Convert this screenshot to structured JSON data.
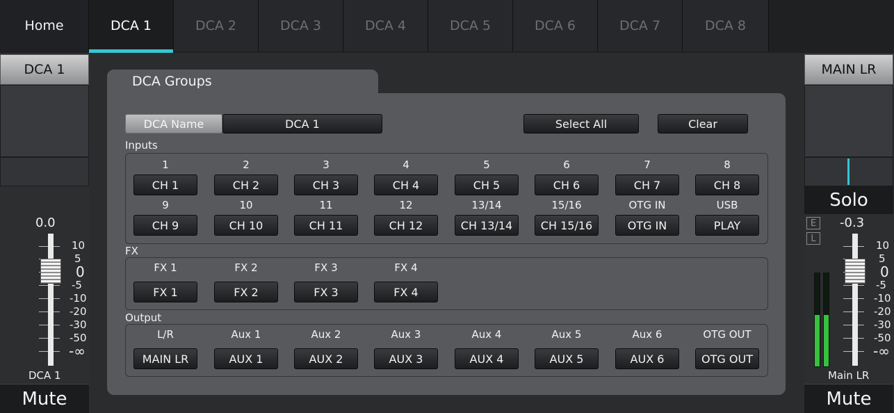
{
  "tabs": [
    "Home",
    "DCA 1",
    "DCA 2",
    "DCA 3",
    "DCA 4",
    "DCA 5",
    "DCA 6",
    "DCA 7",
    "DCA 8"
  ],
  "active_tab": "DCA 1",
  "left_strip": {
    "title": "DCA 1",
    "fader_value": "0.0",
    "name": "DCA 1",
    "mute": "Mute",
    "scale": [
      "10",
      "5",
      "0",
      "-5",
      "-10",
      "-20",
      "-30",
      "-50",
      "-∞"
    ]
  },
  "right_strip": {
    "title": "MAIN LR",
    "solo": "Solo",
    "fader_value": "-0.3",
    "e_label": "E",
    "l_label": "L",
    "name": "Main LR",
    "mute": "Mute",
    "scale": [
      "10",
      "5",
      "0",
      "-5",
      "-10",
      "-20",
      "-30",
      "-50",
      "-∞"
    ],
    "meter_levels": [
      0.55,
      0.55
    ]
  },
  "dca_groups": {
    "tab_title": "DCA Groups",
    "dca_name_label": "DCA Name",
    "dca_name_value": "DCA 1",
    "select_all": "Select All",
    "clear": "Clear",
    "inputs_label": "Inputs",
    "inputs_row1": [
      {
        "num": "1",
        "btn": "CH 1"
      },
      {
        "num": "2",
        "btn": "CH 2"
      },
      {
        "num": "3",
        "btn": "CH 3"
      },
      {
        "num": "4",
        "btn": "CH 4"
      },
      {
        "num": "5",
        "btn": "CH 5"
      },
      {
        "num": "6",
        "btn": "CH 6"
      },
      {
        "num": "7",
        "btn": "CH 7"
      },
      {
        "num": "8",
        "btn": "CH 8"
      }
    ],
    "inputs_row2": [
      {
        "num": "9",
        "btn": "CH 9"
      },
      {
        "num": "10",
        "btn": "CH 10"
      },
      {
        "num": "11",
        "btn": "CH 11"
      },
      {
        "num": "12",
        "btn": "CH 12"
      },
      {
        "num": "13/14",
        "btn": "CH 13/14"
      },
      {
        "num": "15/16",
        "btn": "CH 15/16"
      },
      {
        "num": "OTG IN",
        "btn": "OTG IN"
      },
      {
        "num": "USB",
        "btn": "PLAY"
      }
    ],
    "fx_label": "FX",
    "fx": [
      {
        "num": "FX 1",
        "btn": "FX 1"
      },
      {
        "num": "FX 2",
        "btn": "FX 2"
      },
      {
        "num": "FX 3",
        "btn": "FX 3"
      },
      {
        "num": "FX 4",
        "btn": "FX 4"
      }
    ],
    "output_label": "Output",
    "outputs": [
      {
        "num": "L/R",
        "btn": "MAIN LR"
      },
      {
        "num": "Aux 1",
        "btn": "AUX 1"
      },
      {
        "num": "Aux 2",
        "btn": "AUX 2"
      },
      {
        "num": "Aux 3",
        "btn": "AUX 3"
      },
      {
        "num": "Aux 4",
        "btn": "AUX 4"
      },
      {
        "num": "Aux 5",
        "btn": "AUX 5"
      },
      {
        "num": "Aux 6",
        "btn": "AUX 6"
      },
      {
        "num": "OTG OUT",
        "btn": "OTG OUT"
      }
    ]
  },
  "colors": {
    "accent": "#35c6d6",
    "meter": "#36c13e"
  }
}
